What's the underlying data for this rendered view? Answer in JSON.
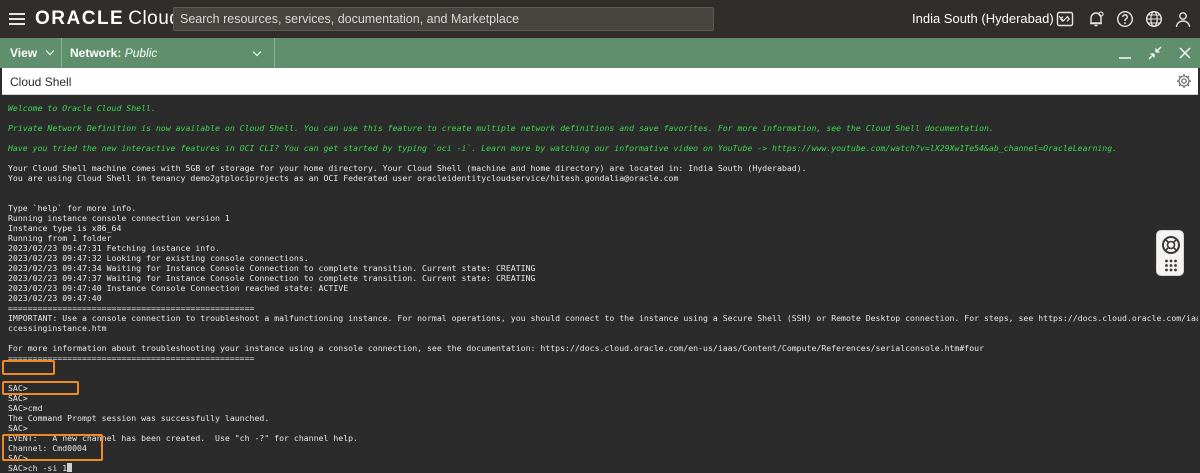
{
  "topbar": {
    "brand": "ORACLE",
    "product": "Cloud",
    "search_placeholder": "Search resources, services, documentation, and Marketplace",
    "region": "India South (Hyderabad)",
    "icons": [
      "hamburger-menu-icon",
      "code-editor-icon",
      "bell-icon",
      "help-icon",
      "globe-icon",
      "profile-icon"
    ]
  },
  "shellbar": {
    "view_label": "View",
    "network_label": "Network:",
    "network_value": "Public",
    "icons": [
      "minimize-icon",
      "restore-icon",
      "close-icon"
    ]
  },
  "window": {
    "title": "Cloud Shell"
  },
  "terminal": {
    "welcome": "Welcome to Oracle Cloud Shell.",
    "private_network": "Private Network Definition is now available on Cloud Shell. You can use this feature to create multiple network definitions and save favorites. For more information, see the Cloud Shell documentation.",
    "cli_tip": "Have you tried the new interactive features in OCI CLI? You can get started by typing `oci -i`. Learn more by watching our informative video on YouTube -> https://www.youtube.com/watch?v=lX29Xw1Te54&ab_channel=OracleLearning.",
    "storage": "Your Cloud Shell machine comes with 5GB of storage for your home directory. Your Cloud Shell (machine and home directory) are located in: India South (Hyderabad).",
    "tenancy": "You are using Cloud Shell in tenancy demo2gtplociprojects as an OCI Federated user oracleidentitycloudservice/hitesh.gondalia@oracle.com",
    "help": "Type `help` for more info.",
    "run1": "Running instance console connection version 1",
    "run2": "Instance type is x86_64",
    "run3": "Running from 1 folder",
    "log1": "2023/02/23 09:47:31 Fetching instance info.",
    "log2": "2023/02/23 09:47:32 Looking for existing console connections.",
    "log3": "2023/02/23 09:47:34 Waiting for Instance Console Connection to complete transition. Current state: CREATING",
    "log4": "2023/02/23 09:47:37 Waiting for Instance Console Connection to complete transition. Current state: CREATING",
    "log5": "2023/02/23 09:47:40 Instance Console Connection reached state: ACTIVE",
    "log6": "2023/02/23 09:47:40",
    "rule": "==================================================",
    "important1": "IMPORTANT: Use a console connection to troubleshoot a malfunctioning instance. For normal operations, you should connect to the instance using a Secure Shell (SSH) or Remote Desktop connection. For steps, see https://docs.cloud.oracle.com/iaas/Content/Compute/Tasks/a",
    "important2": "ccessinginstance.htm",
    "moreinfo": "For more information about troubleshooting your instance using a console connection, see the documentation: https://docs.cloud.oracle.com/en-us/iaas/Content/Compute/References/serialconsole.htm#four",
    "sac1": "SAC>",
    "sac2": "SAC>",
    "sac_cmd": "SAC>cmd",
    "cmd_launched": "The Command Prompt session was successfully launched.",
    "sac3": "SAC>",
    "event": "EVENT:   A new channel has been created.  Use \"ch -?\" for channel help.",
    "channel": "Channel: Cmd0004",
    "sac4": "SAC>",
    "sac_ch": "SAC>ch -si 1"
  },
  "colors": {
    "topbar_bg": "#312d2a",
    "shellbar_bg": "#5f8f6c",
    "terminal_bg": "#2b2b2b",
    "terminal_green": "#3cd84e",
    "highlight": "#f08a24"
  }
}
